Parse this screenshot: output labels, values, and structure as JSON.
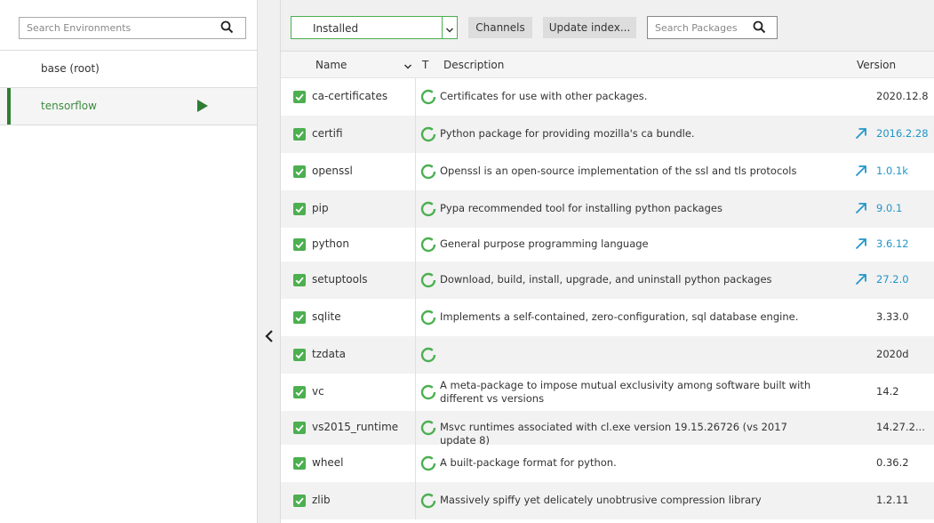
{
  "environments": {
    "search_placeholder": "Search Environments",
    "items": [
      {
        "label": "base (root)",
        "active": false
      },
      {
        "label": "tensorflow",
        "active": true
      }
    ]
  },
  "toolbar": {
    "filter_value": "Installed",
    "channels_label": "Channels",
    "update_label": "Update index...",
    "search_placeholder": "Search Packages"
  },
  "table": {
    "headers": {
      "name": "Name",
      "type": "T",
      "description": "Description",
      "version": "Version"
    },
    "rows": [
      {
        "name": "ca-certificates",
        "description": "Certificates for use with other packages.",
        "version": "2020.12.8",
        "upgradable": false
      },
      {
        "name": "certifi",
        "description": "Python package for providing mozilla's ca bundle.",
        "version": "2016.2.28",
        "upgradable": true
      },
      {
        "name": "openssl",
        "description": "Openssl is an open-source implementation of the ssl and tls protocols",
        "version": "1.0.1k",
        "upgradable": true
      },
      {
        "name": "pip",
        "description": "Pypa recommended tool for installing python packages",
        "version": "9.0.1",
        "upgradable": true
      },
      {
        "name": "python",
        "description": "General purpose programming language",
        "version": "3.6.12",
        "upgradable": true
      },
      {
        "name": "setuptools",
        "description": "Download, build, install, upgrade, and uninstall python packages",
        "version": "27.2.0",
        "upgradable": true
      },
      {
        "name": "sqlite",
        "description": "Implements a self-contained, zero-configuration, sql database engine.",
        "version": "3.33.0",
        "upgradable": false
      },
      {
        "name": "tzdata",
        "description": "",
        "version": "2020d",
        "upgradable": false
      },
      {
        "name": "vc",
        "description": "A meta-package to impose mutual exclusivity among software built with different vs versions",
        "version": "14.2",
        "upgradable": false
      },
      {
        "name": "vs2015_runtime",
        "description": "Msvc runtimes associated with cl.exe version 19.15.26726 (vs 2017 update 8)",
        "version": "14.27.2...",
        "upgradable": false
      },
      {
        "name": "wheel",
        "description": "A built-package format for python.",
        "version": "0.36.2",
        "upgradable": false
      },
      {
        "name": "zlib",
        "description": "Massively spiffy yet delicately unobtrusive compression library",
        "version": "1.2.11",
        "upgradable": false
      }
    ]
  },
  "colors": {
    "accent_green": "#4caf50",
    "active_env_text": "#3d8b40",
    "upgrade_blue": "#2196c9"
  },
  "icons": {
    "search": "search-icon",
    "play": "play-icon",
    "collapse": "chevron-left-icon",
    "sort": "chevron-down-icon",
    "checkbox": "checkbox-checked-icon",
    "status": "installed-status-icon",
    "upgrade": "upgrade-arrow-icon"
  }
}
